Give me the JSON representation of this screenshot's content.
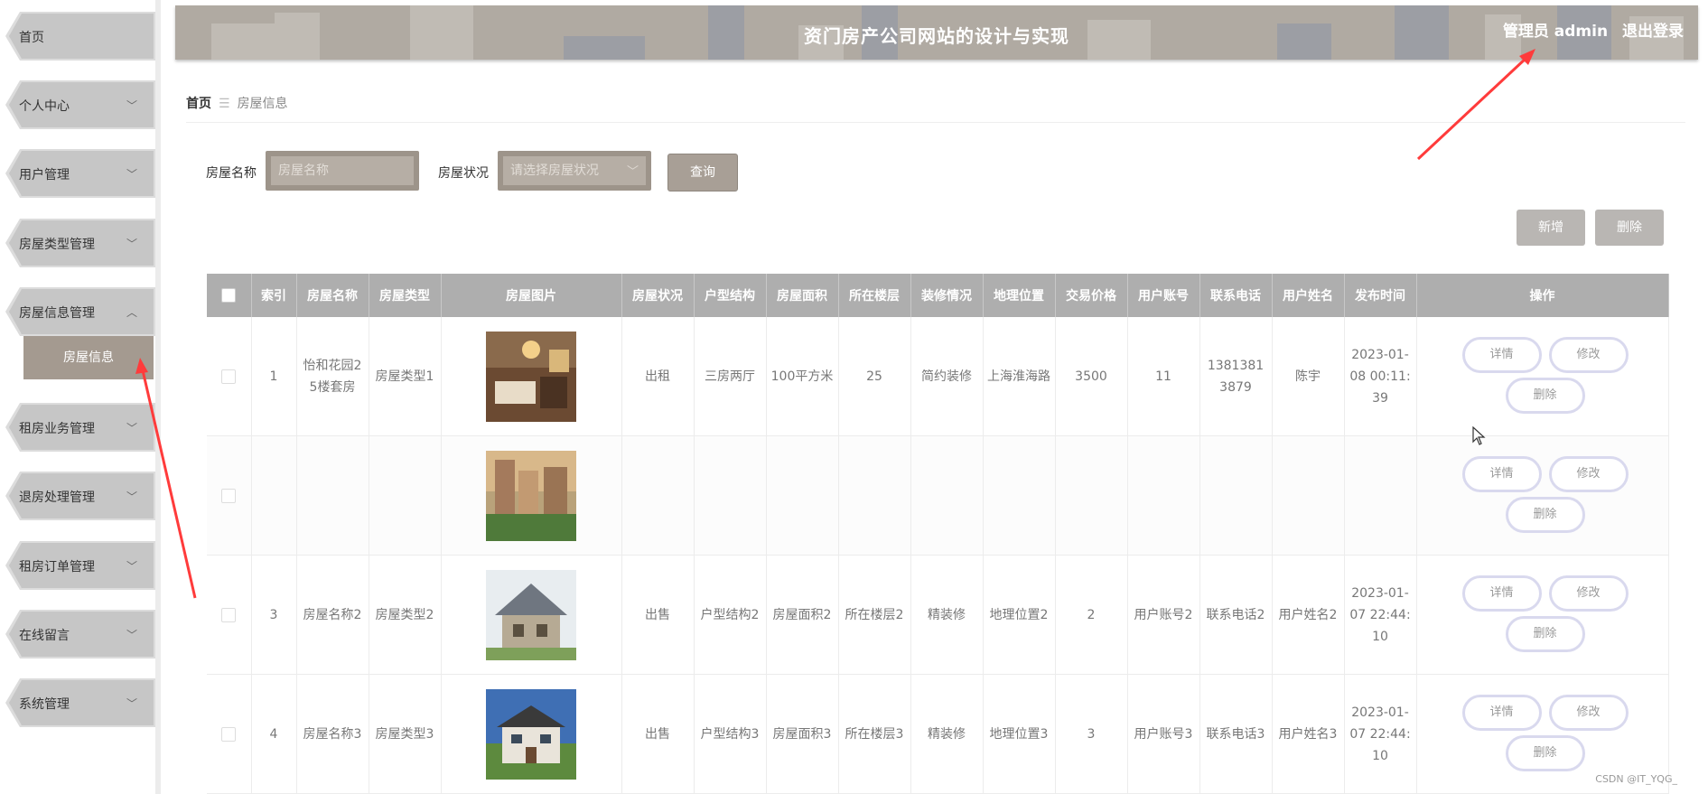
{
  "app": {
    "title": "资门房产公司网站的设计与实现",
    "user_label": "管理员 admin",
    "logout_label": "退出登录"
  },
  "sidebar": {
    "items": [
      {
        "label": "首页",
        "expanded": false
      },
      {
        "label": "个人中心",
        "expanded": false
      },
      {
        "label": "用户管理",
        "expanded": false
      },
      {
        "label": "房屋类型管理",
        "expanded": false
      },
      {
        "label": "房屋信息管理",
        "expanded": true
      },
      {
        "label": "租房业务管理",
        "expanded": false
      },
      {
        "label": "退房处理管理",
        "expanded": false
      },
      {
        "label": "租房订单管理",
        "expanded": false
      },
      {
        "label": "在线留言",
        "expanded": false
      },
      {
        "label": "系统管理",
        "expanded": false
      }
    ],
    "active_sub": "房屋信息"
  },
  "breadcrumb": {
    "home": "首页",
    "current": "房屋信息"
  },
  "search": {
    "name_label": "房屋名称",
    "name_placeholder": "房屋名称",
    "status_label": "房屋状况",
    "status_placeholder": "请选择房屋状况",
    "query_label": "查询"
  },
  "actions": {
    "add_label": "新增",
    "delete_label": "删除"
  },
  "table": {
    "headers": [
      "索引",
      "房屋名称",
      "房屋类型",
      "房屋图片",
      "房屋状况",
      "户型结构",
      "房屋面积",
      "所在楼层",
      "装修情况",
      "地理位置",
      "交易价格",
      "用户账号",
      "联系电话",
      "用户姓名",
      "发布时间",
      "操作"
    ],
    "rows": [
      {
        "index": "1",
        "name": "怡和花园25楼套房",
        "type": "房屋类型1",
        "status": "出租",
        "layout": "三房两厅",
        "area": "100平方米",
        "floor": "25",
        "decoration": "简约装修",
        "location": "上海淮海路",
        "price": "3500",
        "account": "11",
        "phone": "13813813879",
        "username": "陈宇",
        "time": "2023-01-08 00:11:39",
        "image": "hotel-room"
      },
      {
        "index": "",
        "name": "",
        "type": "",
        "status": "",
        "layout": "",
        "area": "",
        "floor": "",
        "decoration": "",
        "location": "",
        "price": "",
        "account": "",
        "phone": "",
        "username": "",
        "time": "",
        "image": "apartment-buildings"
      },
      {
        "index": "3",
        "name": "房屋名称2",
        "type": "房屋类型2",
        "status": "出售",
        "layout": "户型结构2",
        "area": "房屋面积2",
        "floor": "所在楼层2",
        "decoration": "精装修",
        "location": "地理位置2",
        "price": "2",
        "account": "用户账号2",
        "phone": "联系电话2",
        "username": "用户姓名2",
        "time": "2023-01-07 22:44:10",
        "image": "stone-villa"
      },
      {
        "index": "4",
        "name": "房屋名称3",
        "type": "房屋类型3",
        "status": "出售",
        "layout": "户型结构3",
        "area": "房屋面积3",
        "floor": "所在楼层3",
        "decoration": "精装修",
        "location": "地理位置3",
        "price": "3",
        "account": "用户账号3",
        "phone": "联系电话3",
        "username": "用户姓名3",
        "time": "2023-01-07 22:44:10",
        "image": "two-story-villa"
      }
    ],
    "op_labels": {
      "detail": "详情",
      "edit": "修改",
      "delete": "删除"
    }
  },
  "watermark": "CSDN @IT_YQG_",
  "colors": {
    "accent": "#a49a90",
    "header_bg": "#b0aaa2",
    "table_header": "#aeaeae",
    "annotation_arrow": "#ff3b3b"
  }
}
